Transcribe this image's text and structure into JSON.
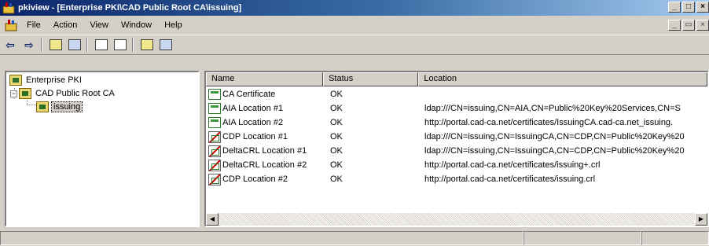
{
  "window": {
    "title": "pkiview - [Enterprise PKI\\CAD Public Root CA\\issuing]",
    "minimize_glyph": "_",
    "maximize_glyph": "□",
    "close_glyph": "×",
    "restore_glyph": "▭"
  },
  "menu": {
    "items": [
      "File",
      "Action",
      "View",
      "Window",
      "Help"
    ]
  },
  "toolbar": {
    "back_glyph": "⇦",
    "forward_glyph": "⇨"
  },
  "tree": {
    "root": "Enterprise PKI",
    "ca": "CAD Public Root CA",
    "selected": "issuing",
    "expander_glyph": "−"
  },
  "list": {
    "columns": [
      "Name",
      "Status",
      "Location"
    ],
    "rows": [
      {
        "name": "CA Certificate",
        "status": "OK",
        "location": "",
        "icon": "certificate-icon"
      },
      {
        "name": "AIA Location #1",
        "status": "OK",
        "location": "ldap:///CN=issuing,CN=AIA,CN=Public%20Key%20Services,CN=S",
        "icon": "certificate-icon"
      },
      {
        "name": "AIA Location #2",
        "status": "OK",
        "location": "http://portal.cad-ca.net/certificates/IssuingCA.cad-ca.net_issuing.",
        "icon": "certificate-icon"
      },
      {
        "name": "CDP Location #1",
        "status": "OK",
        "location": "ldap:///CN=issuing,CN=IssuingCA,CN=CDP,CN=Public%20Key%20",
        "icon": "crl-icon"
      },
      {
        "name": "DeltaCRL Location #1",
        "status": "OK",
        "location": "ldap:///CN=issuing,CN=IssuingCA,CN=CDP,CN=Public%20Key%20",
        "icon": "crl-icon"
      },
      {
        "name": "DeltaCRL Location #2",
        "status": "OK",
        "location": "http://portal.cad-ca.net/certificates/issuing+.crl",
        "icon": "crl-icon"
      },
      {
        "name": "CDP Location #2",
        "status": "OK",
        "location": "http://portal.cad-ca.net/certificates/issuing.crl",
        "icon": "crl-icon"
      }
    ]
  },
  "scrollbar": {
    "left_glyph": "◀",
    "right_glyph": "▶"
  },
  "colors": {
    "titlebar_start": "#0a246a",
    "titlebar_end": "#a6caf0",
    "chrome": "#d4d0c8"
  }
}
